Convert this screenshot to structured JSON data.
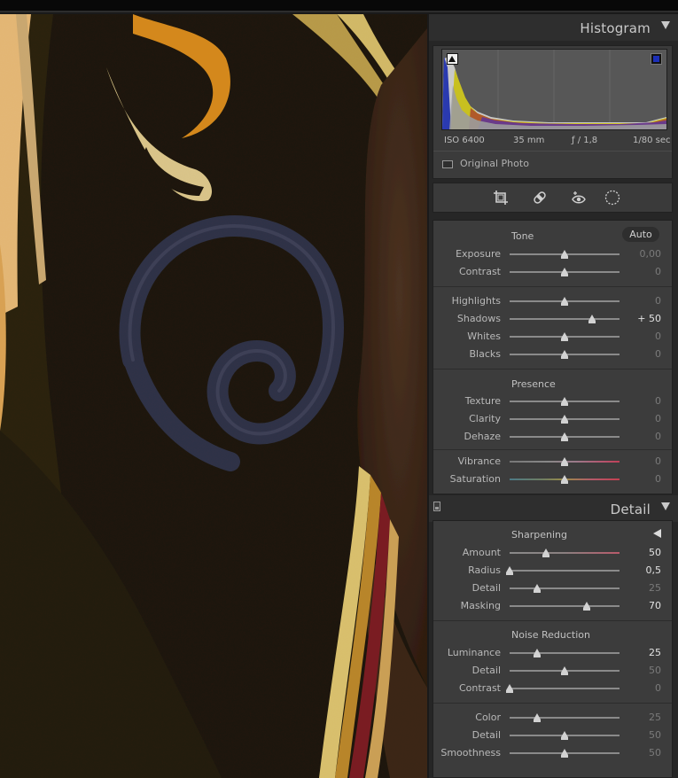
{
  "histogram": {
    "title": "Histogram",
    "iso": "ISO 6400",
    "focal": "35 mm",
    "aperture": "ƒ / 1,8",
    "shutter": "1/80 sec",
    "original_photo_label": "Original Photo"
  },
  "tools": [
    "crop-icon",
    "heal-icon",
    "redeye-icon",
    "mask-icon"
  ],
  "basic": {
    "tone": {
      "title": "Tone",
      "auto_label": "Auto",
      "sliders": [
        {
          "label": "Exposure",
          "value": "0,00",
          "pos": 0.5
        },
        {
          "label": "Contrast",
          "value": "0",
          "pos": 0.5
        },
        {
          "label": "Highlights",
          "value": "0",
          "pos": 0.5
        },
        {
          "label": "Shadows",
          "value": "+ 50",
          "pos": 0.75,
          "active": true
        },
        {
          "label": "Whites",
          "value": "0",
          "pos": 0.5
        },
        {
          "label": "Blacks",
          "value": "0",
          "pos": 0.5
        }
      ]
    },
    "presence": {
      "title": "Presence",
      "sliders": [
        {
          "label": "Texture",
          "value": "0",
          "pos": 0.5
        },
        {
          "label": "Clarity",
          "value": "0",
          "pos": 0.5
        },
        {
          "label": "Dehaze",
          "value": "0",
          "pos": 0.5
        },
        {
          "label": "Vibrance",
          "value": "0",
          "pos": 0.5
        },
        {
          "label": "Saturation",
          "value": "0",
          "pos": 0.5
        }
      ]
    }
  },
  "detail": {
    "title": "Detail",
    "sharpening": {
      "title": "Sharpening",
      "sliders": [
        {
          "label": "Amount",
          "value": "50",
          "pos": 0.333,
          "active": true
        },
        {
          "label": "Radius",
          "value": "0,5",
          "pos": 0.0,
          "active": true
        },
        {
          "label": "Detail",
          "value": "25",
          "pos": 0.25
        },
        {
          "label": "Masking",
          "value": "70",
          "pos": 0.7,
          "active": true
        }
      ]
    },
    "noise": {
      "title": "Noise Reduction",
      "sliders": [
        {
          "label": "Luminance",
          "value": "25",
          "pos": 0.25,
          "active": true
        },
        {
          "label": "Detail",
          "value": "50",
          "pos": 0.5
        },
        {
          "label": "Contrast",
          "value": "0",
          "pos": 0.0
        },
        {
          "label": "Color",
          "value": "25",
          "pos": 0.25
        },
        {
          "label": "Detail",
          "value": "50",
          "pos": 0.5
        },
        {
          "label": "Smoothness",
          "value": "50",
          "pos": 0.5
        }
      ]
    }
  }
}
